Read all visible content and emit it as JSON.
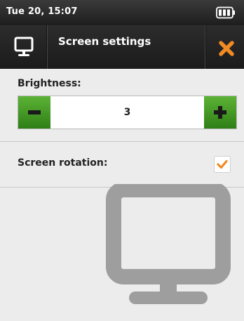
{
  "status_bar": {
    "datetime": "Tue 20, 15:07",
    "battery_icon": "battery-icon"
  },
  "header": {
    "icon": "monitor-icon",
    "title": "Screen settings",
    "close_icon": "close-icon"
  },
  "brightness": {
    "label": "Brightness:",
    "value": "3",
    "decrease_icon": "minus-icon",
    "increase_icon": "plus-icon"
  },
  "screen_rotation": {
    "label": "Screen rotation:",
    "checked": true,
    "check_icon": "checkmark-icon"
  },
  "background_icon": "monitor-icon",
  "colors": {
    "accent_green": "#3f9a22",
    "close_orange": "#f08a24",
    "check_orange": "#f08a24"
  }
}
